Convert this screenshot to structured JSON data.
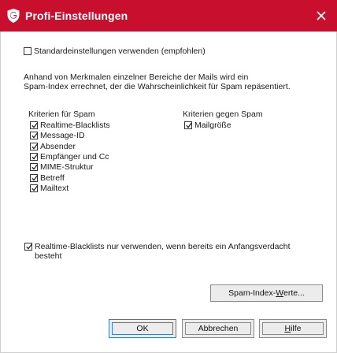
{
  "window": {
    "title": "Profi-Einstellungen",
    "brand_color": "#c8102e"
  },
  "default_settings": {
    "label": "Standardeinstellungen verwenden (empfohlen)",
    "checked": false
  },
  "description": {
    "line1": "Anhand von Merkmalen einzelner Bereiche der Mails wird ein",
    "line2": "Spam-Index errechnet, der die Wahrscheinlichkeit für Spam repäsentiert."
  },
  "criteria_for_spam": {
    "title": "Kriterien für Spam",
    "items": [
      {
        "label": "Realtime-Blacklists",
        "checked": true
      },
      {
        "label": "Message-ID",
        "checked": true
      },
      {
        "label": "Absender",
        "checked": true
      },
      {
        "label": "Empfänger und Cc",
        "checked": true
      },
      {
        "label": "MIME-Struktur",
        "checked": true
      },
      {
        "label": "Betreff",
        "checked": true
      },
      {
        "label": "Mailtext",
        "checked": true
      }
    ]
  },
  "criteria_against_spam": {
    "title": "Kriterien gegen Spam",
    "items": [
      {
        "label": "Mailgröße",
        "checked": true
      }
    ]
  },
  "blacklist_option": {
    "line1": "Realtime-Blacklists nur verwenden, wenn bereits ein Anfangsverdacht",
    "line2": "besteht",
    "checked": true
  },
  "buttons": {
    "spam_index_prefix": "Spam-Index-",
    "spam_index_mnemonic": "W",
    "spam_index_suffix": "erte...",
    "ok": "OK",
    "cancel": "Abbrechen",
    "help_mnemonic": "H",
    "help_rest": "ilfe"
  }
}
